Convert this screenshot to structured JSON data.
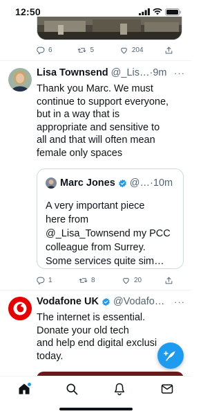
{
  "status_bar": {
    "time": "12:50"
  },
  "top_tweet": {
    "actions": {
      "replies": "6",
      "retweets": "5",
      "likes": "204"
    }
  },
  "tweet1": {
    "name": "Lisa Townsend",
    "handle": "@_Lis…",
    "separator": "·",
    "time": "9m",
    "more": "···",
    "text_lines": [
      "Thank you Marc. We must",
      "continue to support everyone,",
      "but in a way that is",
      "appropriate and sensitive to",
      "all and that will often mean",
      "female only spaces"
    ],
    "quote": {
      "name": "Marc Jones",
      "handle": "@…",
      "separator": "·",
      "time": "10m",
      "text_lines": [
        "A very important piece",
        "here from",
        "@_Lisa_Townsend my PCC",
        "colleague from Surrey.",
        "Some services quite sim…"
      ]
    },
    "actions": {
      "replies": "1",
      "retweets": "8",
      "likes": "20"
    }
  },
  "tweet2": {
    "name": "Vodafone UK",
    "handle": "@Vodafo…",
    "more": "···",
    "text_lines": [
      "The internet is essential.",
      "Donate your old tech",
      "and help end digital exclusi",
      "today."
    ]
  },
  "colors": {
    "accent": "#1d9bf0",
    "text": "#0f1419",
    "muted": "#536471",
    "vodafone": "#e60000"
  },
  "icons": {
    "tabs": [
      "home-icon",
      "search-icon",
      "notifications-icon",
      "messages-icon"
    ],
    "compose": "compose-icon"
  }
}
